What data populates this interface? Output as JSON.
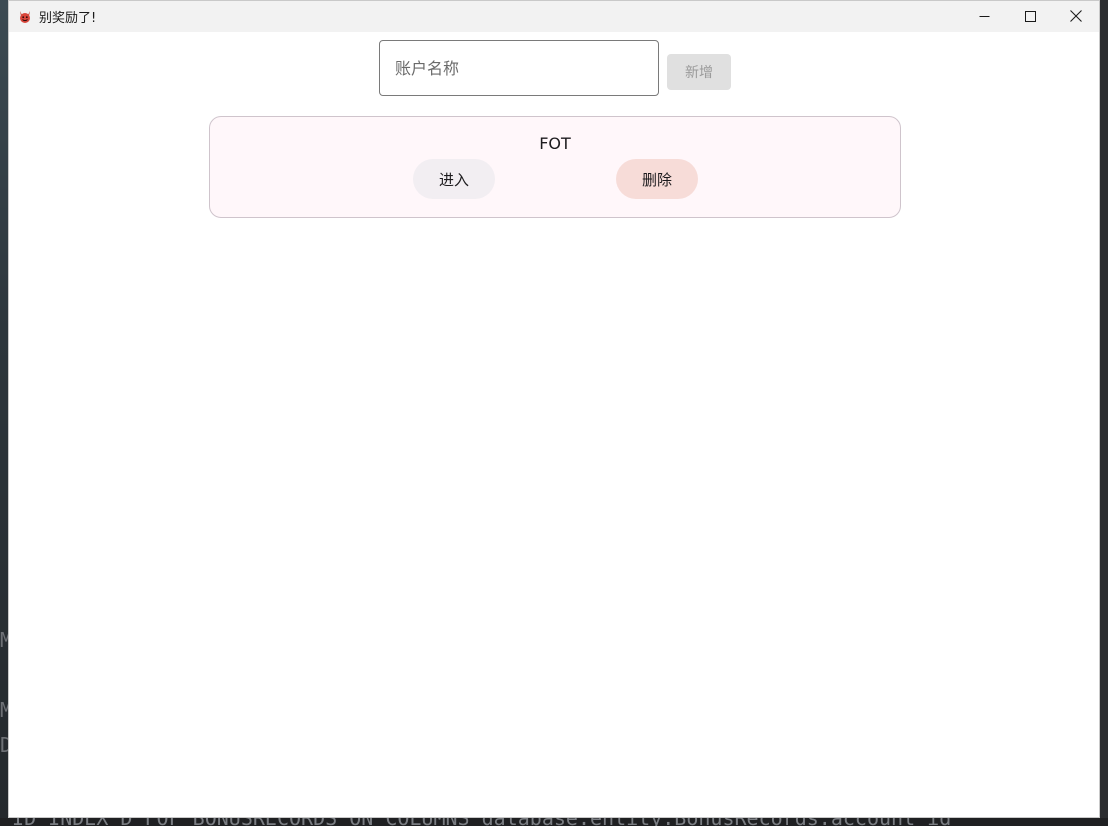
{
  "window": {
    "title": "别奖励了!",
    "controls": [
      "minimize-icon",
      "maximize-icon",
      "close-icon"
    ]
  },
  "form": {
    "account_placeholder": "账户名称",
    "account_value": "",
    "add_label": "新增"
  },
  "accounts": [
    {
      "name": "FOT",
      "enter_label": "进入",
      "delete_label": "删除"
    }
  ],
  "background": {
    "code_bottom": "_ID_INDEX_D  FOF  BONUSRECORDS  ON COLUMNS database.entity.BonusRecords.account_id",
    "code_left_1": "M",
    "code_left_2": "M",
    "code_left_3": "D"
  },
  "colors": {
    "card_bg": "#fff7fa",
    "delete_bg": "#f7dcd8",
    "add_disabled_bg": "#e0e0e0"
  }
}
